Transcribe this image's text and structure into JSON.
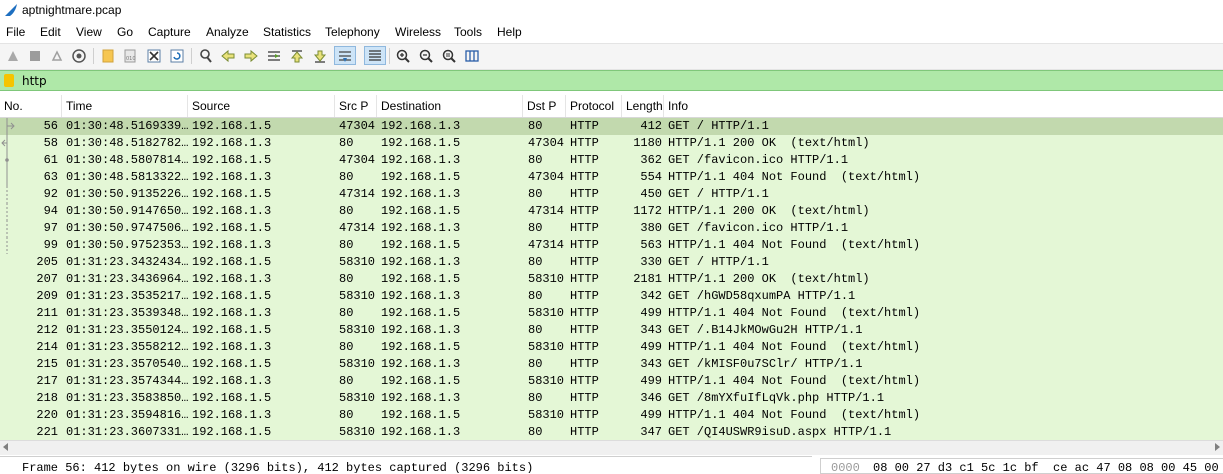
{
  "window": {
    "title": "aptnightmare.pcap"
  },
  "menu": [
    "File",
    "Edit",
    "View",
    "Go",
    "Capture",
    "Analyze",
    "Statistics",
    "Telephony",
    "Wireless",
    "Tools",
    "Help"
  ],
  "filter": {
    "value": "http"
  },
  "columns": [
    "No.",
    "Time",
    "Source",
    "Src P",
    "Destination",
    "Dst P",
    "Protocol",
    "Length",
    "Info"
  ],
  "packets": [
    {
      "no": "56",
      "time": "01:30:48.5169339…",
      "src": "192.168.1.5",
      "sport": "47304",
      "dst": "192.168.1.3",
      "dport": "80",
      "proto": "HTTP",
      "len": "412",
      "info": "GET / HTTP/1.1"
    },
    {
      "no": "58",
      "time": "01:30:48.5182782…",
      "src": "192.168.1.3",
      "sport": "80",
      "dst": "192.168.1.5",
      "dport": "47304",
      "proto": "HTTP",
      "len": "1180",
      "info": "HTTP/1.1 200 OK  (text/html)"
    },
    {
      "no": "61",
      "time": "01:30:48.5807814…",
      "src": "192.168.1.5",
      "sport": "47304",
      "dst": "192.168.1.3",
      "dport": "80",
      "proto": "HTTP",
      "len": "362",
      "info": "GET /favicon.ico HTTP/1.1"
    },
    {
      "no": "63",
      "time": "01:30:48.5813322…",
      "src": "192.168.1.3",
      "sport": "80",
      "dst": "192.168.1.5",
      "dport": "47304",
      "proto": "HTTP",
      "len": "554",
      "info": "HTTP/1.1 404 Not Found  (text/html)"
    },
    {
      "no": "92",
      "time": "01:30:50.9135226…",
      "src": "192.168.1.5",
      "sport": "47314",
      "dst": "192.168.1.3",
      "dport": "80",
      "proto": "HTTP",
      "len": "450",
      "info": "GET / HTTP/1.1"
    },
    {
      "no": "94",
      "time": "01:30:50.9147650…",
      "src": "192.168.1.3",
      "sport": "80",
      "dst": "192.168.1.5",
      "dport": "47314",
      "proto": "HTTP",
      "len": "1172",
      "info": "HTTP/1.1 200 OK  (text/html)"
    },
    {
      "no": "97",
      "time": "01:30:50.9747506…",
      "src": "192.168.1.5",
      "sport": "47314",
      "dst": "192.168.1.3",
      "dport": "80",
      "proto": "HTTP",
      "len": "380",
      "info": "GET /favicon.ico HTTP/1.1"
    },
    {
      "no": "99",
      "time": "01:30:50.9752353…",
      "src": "192.168.1.3",
      "sport": "80",
      "dst": "192.168.1.5",
      "dport": "47314",
      "proto": "HTTP",
      "len": "563",
      "info": "HTTP/1.1 404 Not Found  (text/html)"
    },
    {
      "no": "205",
      "time": "01:31:23.3432434…",
      "src": "192.168.1.5",
      "sport": "58310",
      "dst": "192.168.1.3",
      "dport": "80",
      "proto": "HTTP",
      "len": "330",
      "info": "GET / HTTP/1.1"
    },
    {
      "no": "207",
      "time": "01:31:23.3436964…",
      "src": "192.168.1.3",
      "sport": "80",
      "dst": "192.168.1.5",
      "dport": "58310",
      "proto": "HTTP",
      "len": "2181",
      "info": "HTTP/1.1 200 OK  (text/html)"
    },
    {
      "no": "209",
      "time": "01:31:23.3535217…",
      "src": "192.168.1.5",
      "sport": "58310",
      "dst": "192.168.1.3",
      "dport": "80",
      "proto": "HTTP",
      "len": "342",
      "info": "GET /hGWD58qxumPA HTTP/1.1"
    },
    {
      "no": "211",
      "time": "01:31:23.3539348…",
      "src": "192.168.1.3",
      "sport": "80",
      "dst": "192.168.1.5",
      "dport": "58310",
      "proto": "HTTP",
      "len": "499",
      "info": "HTTP/1.1 404 Not Found  (text/html)"
    },
    {
      "no": "212",
      "time": "01:31:23.3550124…",
      "src": "192.168.1.5",
      "sport": "58310",
      "dst": "192.168.1.3",
      "dport": "80",
      "proto": "HTTP",
      "len": "343",
      "info": "GET /.B14JkMOwGu2H HTTP/1.1"
    },
    {
      "no": "214",
      "time": "01:31:23.3558212…",
      "src": "192.168.1.3",
      "sport": "80",
      "dst": "192.168.1.5",
      "dport": "58310",
      "proto": "HTTP",
      "len": "499",
      "info": "HTTP/1.1 404 Not Found  (text/html)"
    },
    {
      "no": "215",
      "time": "01:31:23.3570540…",
      "src": "192.168.1.5",
      "sport": "58310",
      "dst": "192.168.1.3",
      "dport": "80",
      "proto": "HTTP",
      "len": "343",
      "info": "GET /kMISF0u7SClr/ HTTP/1.1"
    },
    {
      "no": "217",
      "time": "01:31:23.3574344…",
      "src": "192.168.1.3",
      "sport": "80",
      "dst": "192.168.1.5",
      "dport": "58310",
      "proto": "HTTP",
      "len": "499",
      "info": "HTTP/1.1 404 Not Found  (text/html)"
    },
    {
      "no": "218",
      "time": "01:31:23.3583850…",
      "src": "192.168.1.5",
      "sport": "58310",
      "dst": "192.168.1.3",
      "dport": "80",
      "proto": "HTTP",
      "len": "346",
      "info": "GET /8mYXfuIfLqVk.php HTTP/1.1"
    },
    {
      "no": "220",
      "time": "01:31:23.3594816…",
      "src": "192.168.1.3",
      "sport": "80",
      "dst": "192.168.1.5",
      "dport": "58310",
      "proto": "HTTP",
      "len": "499",
      "info": "HTTP/1.1 404 Not Found  (text/html)"
    },
    {
      "no": "221",
      "time": "01:31:23.3607331…",
      "src": "192.168.1.5",
      "sport": "58310",
      "dst": "192.168.1.3",
      "dport": "80",
      "proto": "HTTP",
      "len": "347",
      "info": "GET /QI4USWR9isuD.aspx HTTP/1.1"
    }
  ],
  "selected_packet": "56",
  "details": {
    "frame_summary": "Frame 56: 412 bytes on wire (3296 bits), 412 bytes captured (3296 bits)"
  },
  "bytes": {
    "offset": "0000",
    "hex": "08 00 27 d3 c1 5c 1c bf  ce ac 47 08 08 00 45 00"
  },
  "colors": {
    "row_bg": "#e4f7d6",
    "row_selected": "#c2d9ae",
    "filter_bg": "#afe8a8"
  }
}
